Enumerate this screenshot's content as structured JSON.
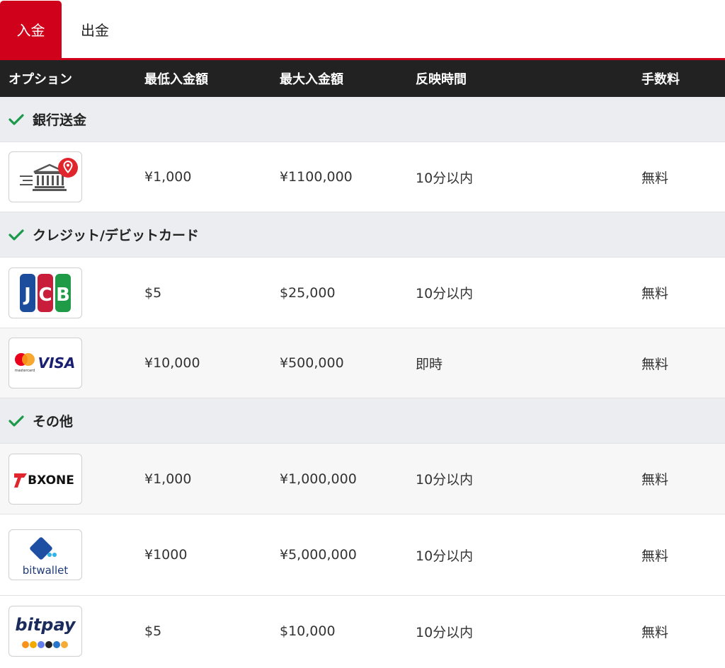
{
  "tabs": [
    {
      "label": "入金",
      "active": true
    },
    {
      "label": "出金",
      "active": false
    }
  ],
  "table": {
    "headers": [
      "オプション",
      "最低入金額",
      "最大入金額",
      "反映時間",
      "手数料"
    ]
  },
  "sections": [
    {
      "label": "銀行送金",
      "rows": [
        {
          "logo": "bank-transfer-icon",
          "min": "¥1,000",
          "max": "¥1100,000",
          "time": "10分以内",
          "fee": "無料"
        }
      ]
    },
    {
      "label": "クレジット/デビットカード",
      "rows": [
        {
          "logo": "jcb-logo",
          "logo_text": "JCB",
          "min": "$5",
          "max": "$25,000",
          "time": "10分以内",
          "fee": "無料"
        },
        {
          "logo": "mastercard-visa-logo",
          "logo_text": "VISA",
          "logo_subtext": "mastercard",
          "min": "¥10,000",
          "max": "¥500,000",
          "time": "即時",
          "fee": "無料"
        }
      ]
    },
    {
      "label": "その他",
      "rows": [
        {
          "logo": "bxone-logo",
          "logo_text": "BXONE",
          "min": "¥1,000",
          "max": "¥1,000,000",
          "time": "10分以内",
          "fee": "無料"
        },
        {
          "logo": "bitwallet-logo",
          "logo_text": "bitwallet",
          "min": "¥1000",
          "max": "¥5,000,000",
          "time": "10分以内",
          "fee": "無料"
        },
        {
          "logo": "bitpay-logo",
          "logo_text": "bitpay",
          "min": "$5",
          "max": "$10,000",
          "time": "10分以内",
          "fee": "無料"
        }
      ]
    }
  ],
  "colors": {
    "accent": "#d0021b",
    "header_bg": "#222222",
    "section_bg": "#ebedf0",
    "check": "#1a9a4a"
  }
}
